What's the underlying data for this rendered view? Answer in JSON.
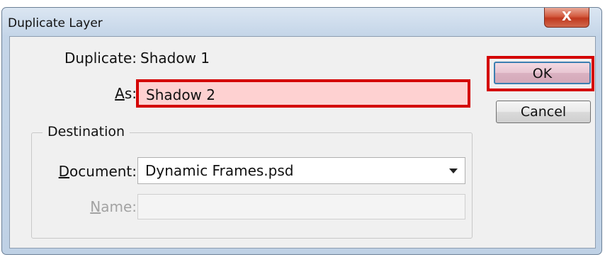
{
  "window": {
    "title": "Duplicate Layer",
    "close_glyph": "X"
  },
  "duplicate": {
    "label": "Duplicate:",
    "value": "Shadow 1"
  },
  "as": {
    "label_mnemonic": "A",
    "label_rest": "s:",
    "value": "Shadow 2"
  },
  "buttons": {
    "ok": "OK",
    "cancel": "Cancel"
  },
  "destination": {
    "legend": "Destination",
    "document": {
      "label_mnemonic": "D",
      "label_rest": "ocument:",
      "value": "Dynamic Frames.psd"
    },
    "name": {
      "label_mnemonic": "N",
      "label_rest": "ame:",
      "value": ""
    }
  },
  "highlight_color": "#d40000",
  "icons": {
    "close": "close-icon",
    "dropdown": "chevron-down-icon"
  }
}
